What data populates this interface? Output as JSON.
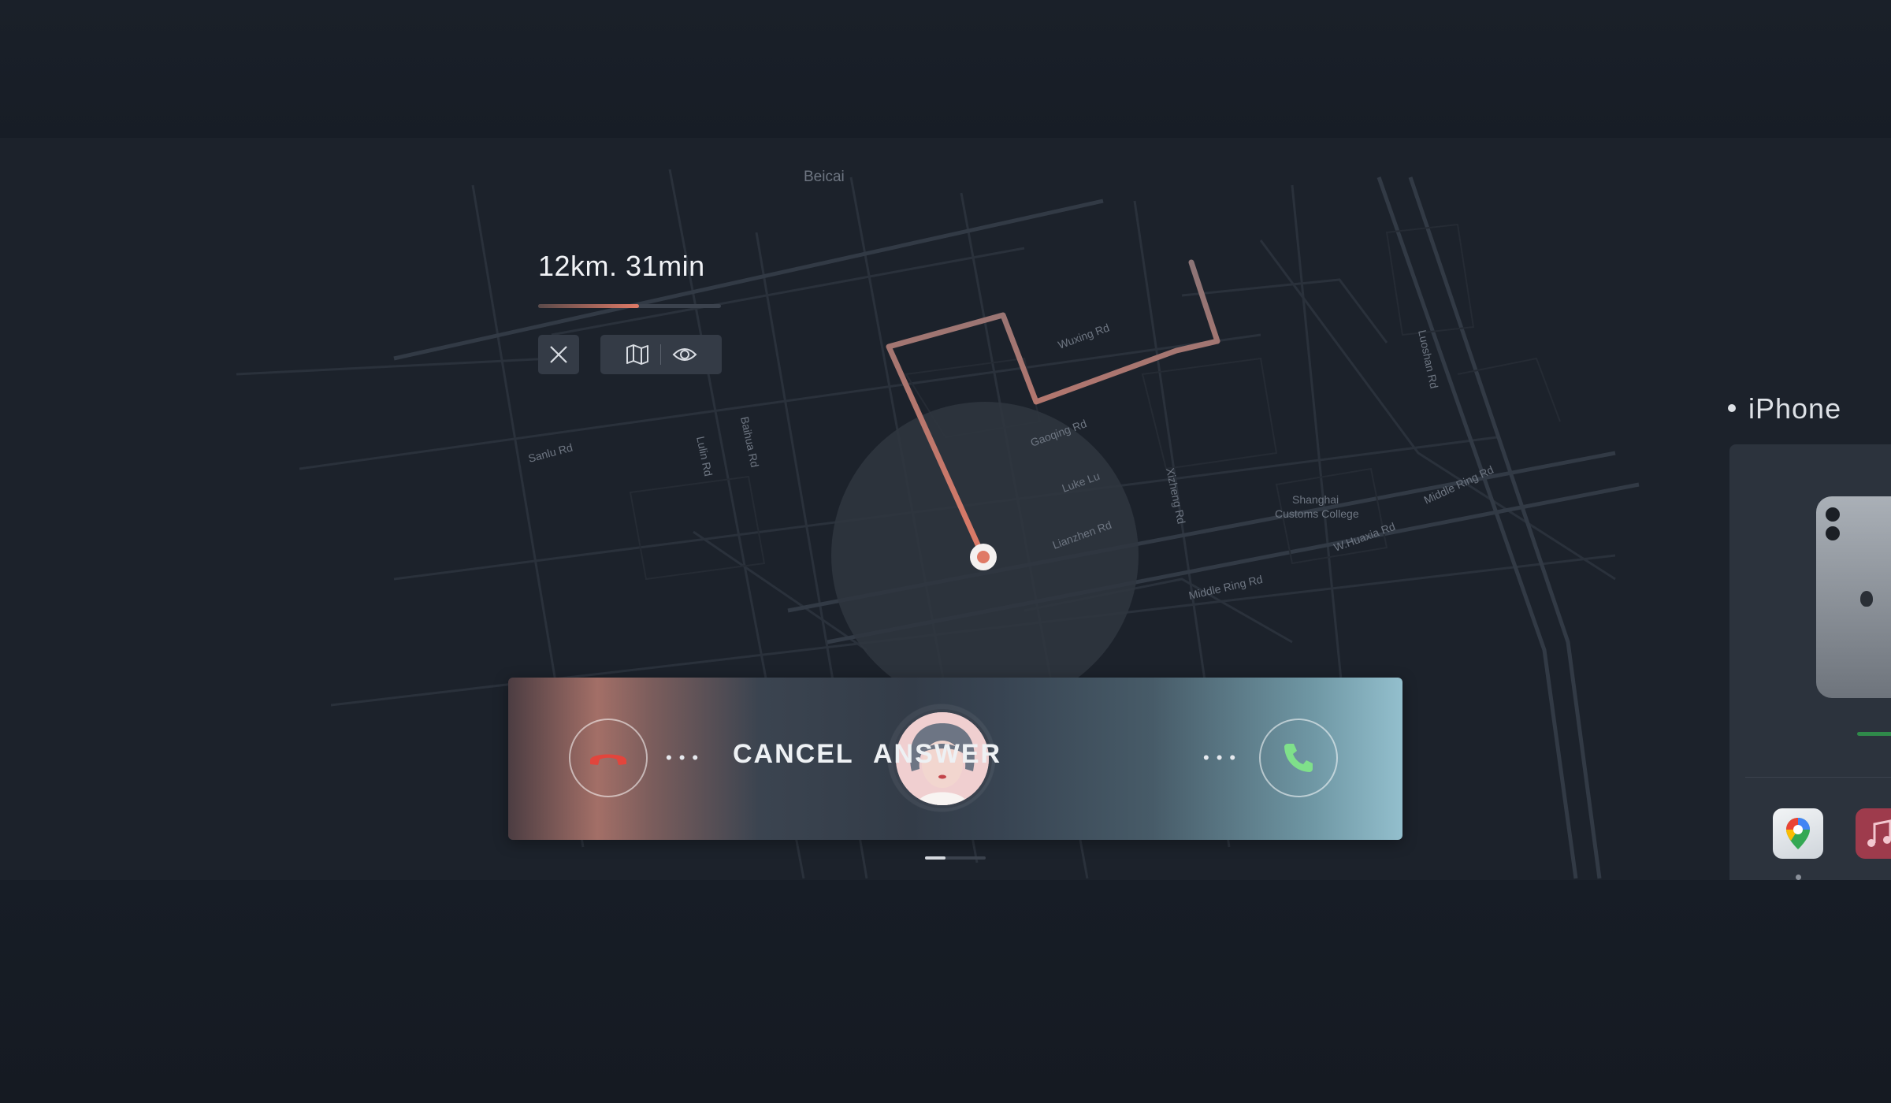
{
  "navigation": {
    "trip_summary": "12km. 31min",
    "progress_fraction": 0.55,
    "controls": [
      "close-icon",
      "map-icon",
      "eye-icon"
    ]
  },
  "map": {
    "labels": {
      "area_top": "Beicai",
      "sanlu": "Sanlu Rd",
      "lulin": "Lulin Rd",
      "baihua": "Baihua Rd",
      "wuxing": "Wuxing Rd",
      "gaoqing": "Gaoqing Rd",
      "xizheng": "Xizheng Rd",
      "lukelu": "Luke Lu",
      "lianzhen": "Lianzhen Rd",
      "college": "Shanghai",
      "college2": "Customs College",
      "middle_ring": "Middle Ring Rd",
      "middle_ring2": "Middle Ring Rd",
      "w_huaxia": "W.Huaxia Rd",
      "luoshan": "Luoshan Rd"
    }
  },
  "call": {
    "decline_label": "CANCEL",
    "accept_label": "ANSWER",
    "decline_color": "#e2453c",
    "accept_color": "#7fe08a"
  },
  "device": {
    "name": "iPhone"
  },
  "apps": [
    "maps-icon",
    "music-icon"
  ],
  "colors": {
    "route": "#e07a66",
    "background": "#1c222b"
  }
}
